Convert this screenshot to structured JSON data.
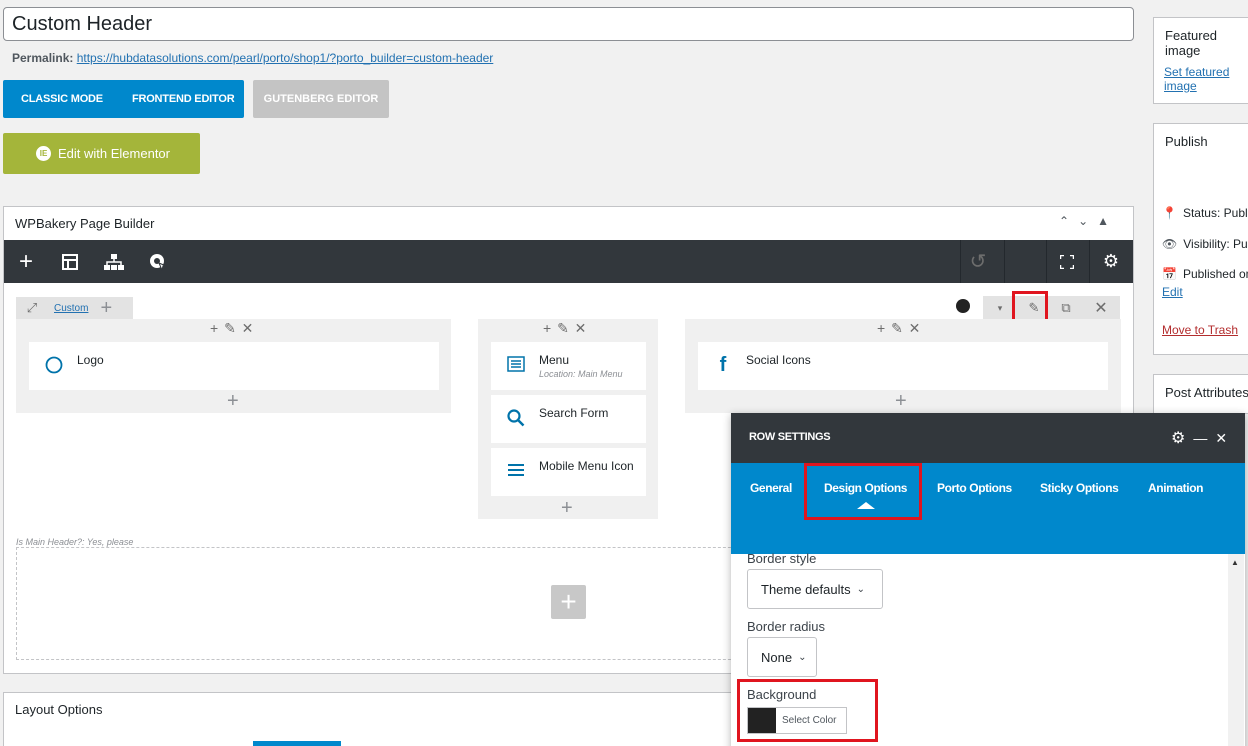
{
  "post": {
    "title": "Custom Header",
    "permalink_label": "Permalink:",
    "permalink_url": "https://hubdatasolutions.com/pearl/porto/shop1/?porto_builder=custom-header"
  },
  "editor_modes": {
    "classic": "CLASSIC MODE",
    "frontend": "FRONTEND EDITOR",
    "gutenberg": "GUTENBERG EDITOR",
    "elementor": "Edit with Elementor"
  },
  "wpbakery": {
    "title": "WPBakery Page Builder",
    "row_label": "Custom",
    "columns": [
      {
        "elements": [
          {
            "name": "Logo",
            "icon": "circle-icon"
          }
        ]
      },
      {
        "elements": [
          {
            "name": "Menu",
            "sub": "Location: Main Menu",
            "icon": "menu-list-icon"
          },
          {
            "name": "Search Form",
            "icon": "search-icon"
          },
          {
            "name": "Mobile Menu Icon",
            "icon": "hamburger-icon"
          }
        ]
      },
      {
        "elements": [
          {
            "name": "Social Icons",
            "icon": "facebook-icon"
          }
        ]
      }
    ],
    "main_header_label": "Is Main Header?: Yes, please"
  },
  "layout_options": {
    "title": "Layout Options"
  },
  "sidebar": {
    "featured_image": {
      "title": "Featured image",
      "link": "Set featured image"
    },
    "publish": {
      "title": "Publish",
      "status": "Status: Publi",
      "visibility": "Visibility: Pu",
      "published": "Published on",
      "edit": "Edit",
      "trash": "Move to Trash"
    },
    "post_attributes": {
      "title": "Post Attributes"
    }
  },
  "row_settings": {
    "title": "ROW SETTINGS",
    "tabs": [
      "General",
      "Design Options",
      "Porto Options",
      "Sticky Options",
      "Animation"
    ],
    "active_tab": "Design Options",
    "fields": {
      "border_style_label": "Border style",
      "border_style_value": "Theme defaults",
      "border_radius_label": "Border radius",
      "border_radius_value": "None",
      "background_label": "Background",
      "select_color": "Select Color"
    }
  },
  "colors": {
    "accent": "#0088cc",
    "toolbar": "#32373c",
    "elementor": "#a4b53a",
    "highlight": "#e0151f"
  }
}
